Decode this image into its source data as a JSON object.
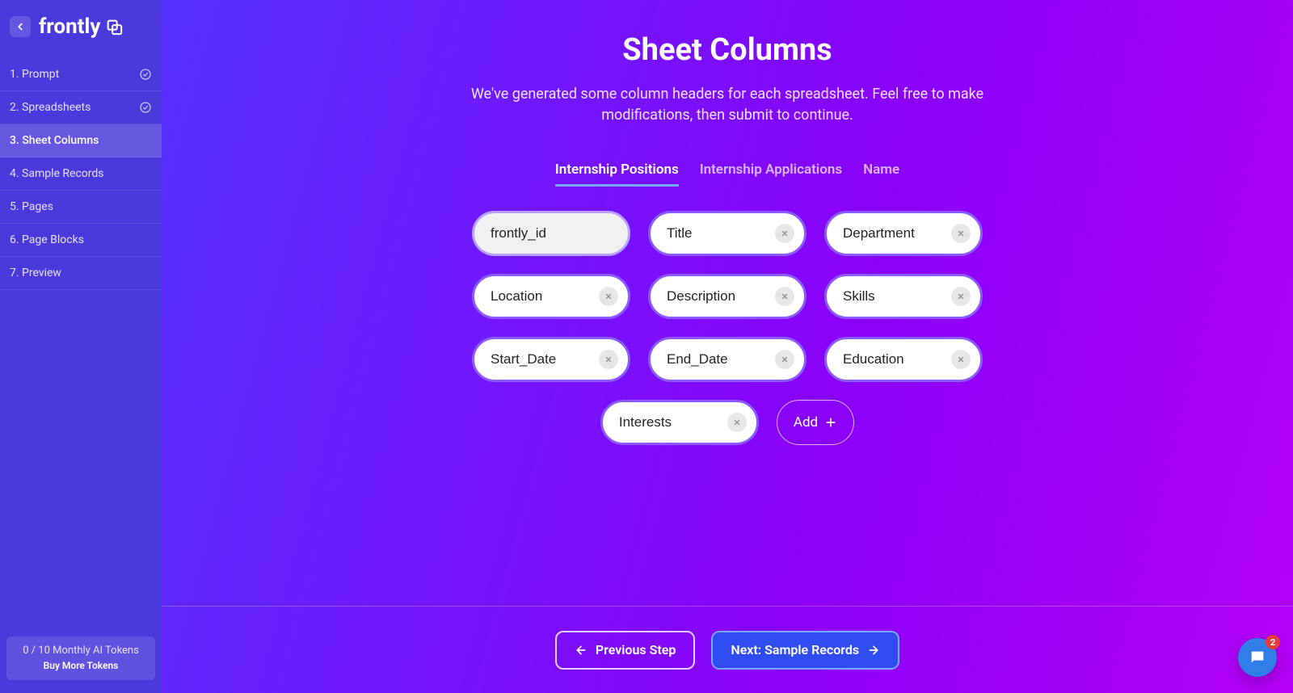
{
  "brand": {
    "name": "frontly"
  },
  "sidebar": {
    "steps": [
      {
        "label": "1. Prompt",
        "completed": true
      },
      {
        "label": "2. Spreadsheets",
        "completed": true
      },
      {
        "label": "3. Sheet Columns",
        "completed": false,
        "active": true
      },
      {
        "label": "4. Sample Records",
        "completed": false
      },
      {
        "label": "5. Pages",
        "completed": false
      },
      {
        "label": "6. Page Blocks",
        "completed": false
      },
      {
        "label": "7. Preview",
        "completed": false
      }
    ],
    "tokens": {
      "count_label": "0 / 10 Monthly AI Tokens",
      "buy_label": "Buy More Tokens"
    }
  },
  "main": {
    "title": "Sheet Columns",
    "subtitle": "We've generated some column headers for each spreadsheet. Feel free to make modifications, then submit to continue.",
    "tabs": [
      {
        "label": "Internship Positions",
        "active": true
      },
      {
        "label": "Internship Applications",
        "active": false
      },
      {
        "label": "Name",
        "active": false
      }
    ],
    "columns": [
      {
        "value": "frontly_id",
        "locked": true
      },
      {
        "value": "Title"
      },
      {
        "value": "Department"
      },
      {
        "value": "Location"
      },
      {
        "value": "Description"
      },
      {
        "value": "Skills"
      },
      {
        "value": "Start_Date"
      },
      {
        "value": "End_Date"
      },
      {
        "value": "Education"
      },
      {
        "value": "Interests"
      }
    ],
    "add_label": "Add"
  },
  "footer": {
    "prev_label": "Previous Step",
    "next_label": "Next: Sample Records"
  },
  "help": {
    "unread": "2"
  }
}
